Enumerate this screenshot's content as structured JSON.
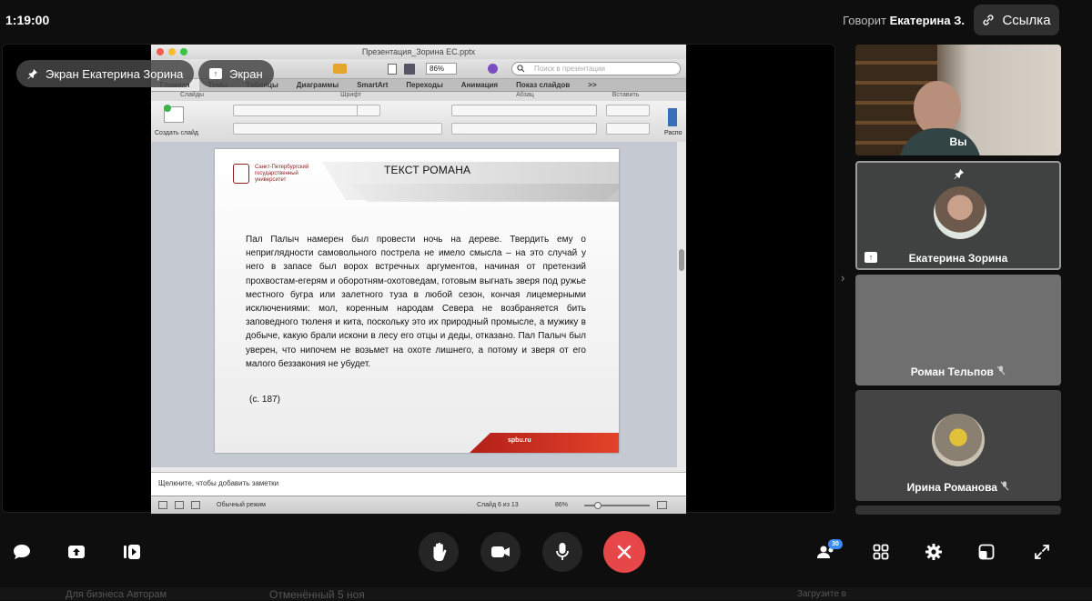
{
  "call": {
    "time": "1:19:00",
    "speaking_prefix": "Говорит",
    "speaking_name": "Екатерина З.",
    "link_label": "Ссылка"
  },
  "stage": {
    "screen_label": "Экран Екатерина Зорина",
    "screen_short": "Экран"
  },
  "ppt": {
    "window_title": "Презентация_Зорина ЕС.pptx",
    "zoom": "86%",
    "search_placeholder": "Поиск в презентации",
    "tabs": [
      "Главная",
      "Темы",
      "Таблицы",
      "Диаграммы",
      "SmartArt",
      "Переходы",
      "Анимация",
      "Показ слайдов",
      ">>"
    ],
    "groups": [
      "Слайды",
      "Шрифт",
      "Абзац",
      "Вставить"
    ],
    "new_slide": "Создать слайд",
    "arrange": "Распо",
    "notes_placeholder": "Щелкните, чтобы добавить заметки",
    "view_mode": "Обычный режим",
    "slide_counter": "Слайд 6 из 13",
    "status_zoom": "86%"
  },
  "slide": {
    "title": "ТЕКСТ РОМАНА",
    "university": "Санкт-Петербургский государственный университет",
    "body": "Пал Палыч намерен был провести ночь на дереве. Твердить ему о неприглядности самовольного пострела не имело смысла – на это случай у него в запасе был ворох встречных аргументов, начиная от претензий прохвостам-егерям и оборотням-охотоведам, готовым выгнать зверя под ружье местного бугра или залетного туза в любой сезон, кончая лицемерными исключениями: мол, коренным народам Севера не возбраняется бить заповедного тюленя и кита, поскольку это их природный промысле, а мужику в добыче, какую брали искони в лесу его отцы и деды, отказано. Пал Палыч был уверен, что нипочем не возьмет на охоте лишнего, а потому и зверя от его малого беззакония не убудет.",
    "citation": "(с. 187)",
    "footer": "spbu.ru"
  },
  "participants": [
    {
      "name": "Вы",
      "muted": false
    },
    {
      "name": "Екатерина Зорина",
      "muted": false,
      "pinned": true
    },
    {
      "name": "Роман Тельпов",
      "muted": true
    },
    {
      "name": "Ирина Романова",
      "muted": true
    }
  ],
  "toolbar": {
    "participants_count": "30"
  },
  "background_strip": {
    "item1": "Для бизнеса   Авторам",
    "item2": "Отменённый  5 ноя",
    "item3": "Загрузите в"
  },
  "colors": {
    "end_call": "#e8474a",
    "badge": "#3c8bf5",
    "slide_accent": "#b31f19"
  }
}
